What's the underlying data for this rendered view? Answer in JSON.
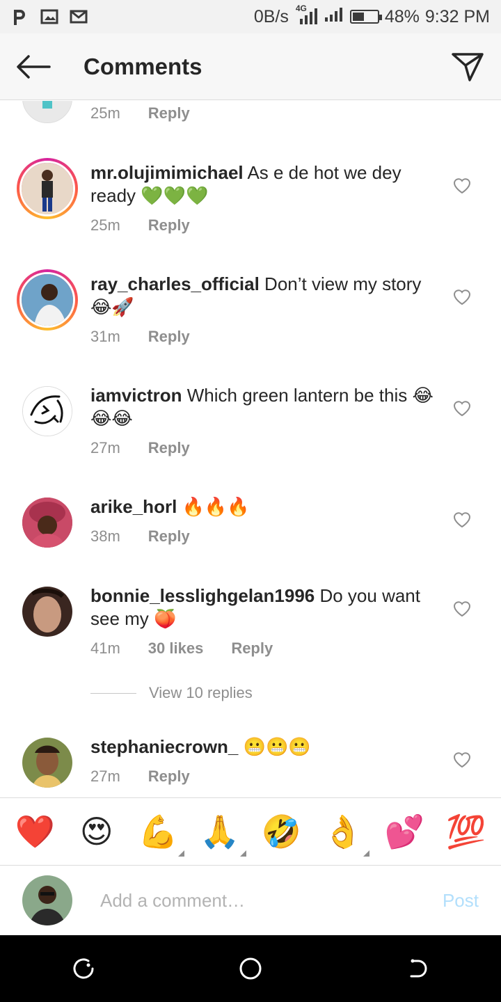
{
  "status_bar": {
    "left_icons": [
      "p-icon",
      "image-icon",
      "gmail-icon"
    ],
    "speed": "0B/s",
    "network": "4G",
    "battery_level": 48,
    "battery_text": "48%",
    "time": "9:32 PM"
  },
  "header": {
    "title": "Comments",
    "back_icon": "arrow-left-icon",
    "send_icon": "send-icon"
  },
  "comments": [
    {
      "username": "",
      "text": "",
      "time": "25m",
      "likes": "",
      "reply_label": "Reply"
    },
    {
      "username": "mr.olujimimichael",
      "text": "As e de hot we dey ready 💚💚💚",
      "time": "25m",
      "likes": "",
      "reply_label": "Reply"
    },
    {
      "username": "ray_charles_official",
      "text": "Don’t view my story 😂🚀",
      "time": "31m",
      "likes": "",
      "reply_label": "Reply"
    },
    {
      "username": "iamvictron",
      "text": "Which green lantern be this 😂😂😂",
      "time": "27m",
      "likes": "",
      "reply_label": "Reply"
    },
    {
      "username": "arike_horl",
      "text": "🔥🔥🔥",
      "time": "38m",
      "likes": "",
      "reply_label": "Reply"
    },
    {
      "username": "bonnie_lesslighgelan1996",
      "text": "Do you want see my 🍑",
      "time": "41m",
      "likes": "30 likes",
      "reply_label": "Reply"
    },
    {
      "username": "stephaniecrown_",
      "text": "😬😬😬",
      "time": "27m",
      "likes": "",
      "reply_label": "Reply"
    }
  ],
  "view_replies": "View 10 replies",
  "emoji_bar": [
    "❤️",
    "😍",
    "💪",
    "🙏",
    "🤣",
    "👌",
    "💕",
    "💯"
  ],
  "input": {
    "placeholder": "Add a comment…",
    "post_label": "Post"
  },
  "nav_bar": [
    "recent-apps-icon",
    "home-icon",
    "back-icon"
  ],
  "colors": {
    "header_bg": "#f7f7f7",
    "post_disabled": "#b2dffc",
    "meta_gray": "#8e8e8e",
    "story_ring": "#d6249f"
  }
}
